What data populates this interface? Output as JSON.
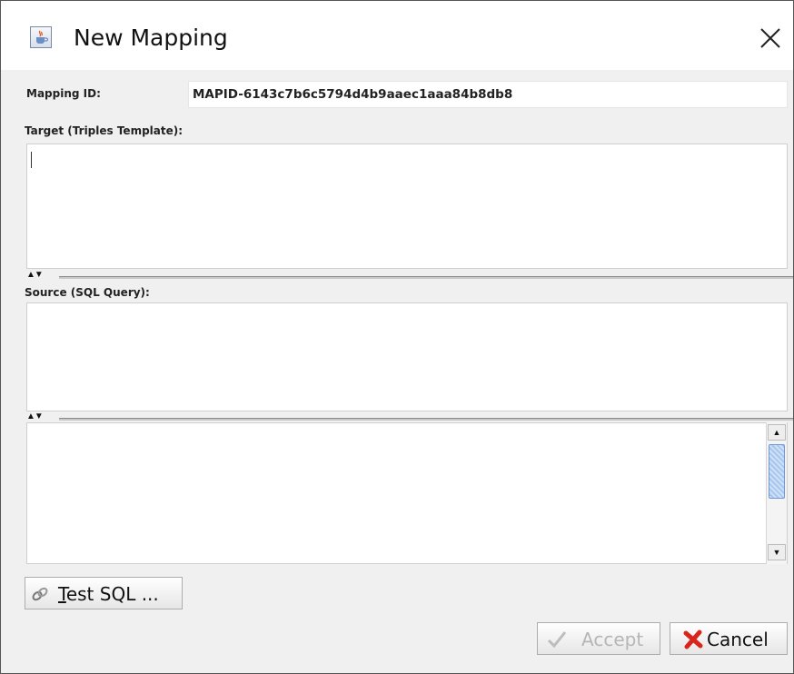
{
  "window": {
    "title": "New Mapping",
    "icon": "java-cup-icon",
    "close_icon": "close-icon"
  },
  "form": {
    "mapping_id_label": "Mapping ID:",
    "mapping_id_value": "MAPID-6143c7b6c5794d4b9aaec1aaa84b8db8",
    "target_label": "Target (Triples Template):",
    "target_value": "",
    "source_label": "Source (SQL Query):",
    "source_value": "",
    "results_value": "",
    "splitter_icon": "splitter-arrows-icon"
  },
  "buttons": {
    "test_sql": "Test SQL ...",
    "test_sql_mnemonic": "T",
    "test_sql_rest": "est SQL ...",
    "accept": "Accept",
    "accept_enabled": false,
    "cancel": "Cancel"
  },
  "colors": {
    "background": "#f0f0f0",
    "field": "#ffffff",
    "cancel_icon": "#d9261c",
    "scroll_thumb": "#a9c6ee"
  }
}
